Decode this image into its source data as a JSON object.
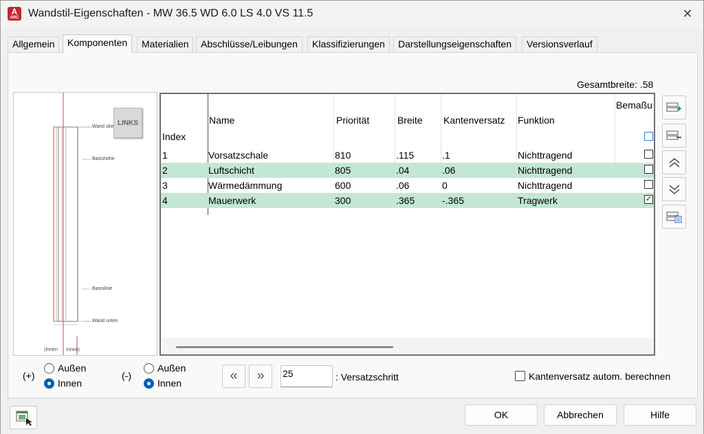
{
  "window": {
    "title": "Wandstil-Eigenschaften - MW 36.5 WD 6.0 LS 4.0 VS 11.5",
    "app_icon_letter": "A",
    "app_icon_sub": "ARC",
    "close_glyph": "✕"
  },
  "tabs": [
    {
      "label": "Allgemein",
      "active": false
    },
    {
      "label": "Komponenten",
      "active": true
    },
    {
      "label": "Materialien",
      "active": false
    },
    {
      "label": "Abschlüsse/Leibungen",
      "active": false
    },
    {
      "label": "Klassifizierungen",
      "active": false
    },
    {
      "label": "Darstellungseigenschaften",
      "active": false
    },
    {
      "label": "Versionsverlauf",
      "active": false
    }
  ],
  "total_width_label": "Gesamtbreite: .58",
  "preview": {
    "badge": "LINKS",
    "labels": {
      "wand_oben": "Wand oben",
      "basishoehe": "Basishöhe",
      "basislinie": "Basislinie",
      "wand_unten": "Wand unten",
      "innen": "(Innen",
      "aussen": "Innen)"
    }
  },
  "grid": {
    "columns": {
      "index": "Index",
      "name": "Name",
      "prioritaet": "Priorität",
      "breite": "Breite",
      "kantenversatz": "Kantenversatz",
      "funktion": "Funktion",
      "bemassung": "Bemaßu"
    },
    "rows": [
      {
        "index": "1",
        "name": "Vorsatzschale",
        "prioritaet": "810",
        "breite": ".115",
        "kantenversatz": ".1",
        "funktion": "Nichttragend",
        "checked": false,
        "selected": false
      },
      {
        "index": "2",
        "name": "Luftschicht",
        "prioritaet": "805",
        "breite": ".04",
        "kantenversatz": ".06",
        "funktion": "Nichttragend",
        "checked": false,
        "selected": true
      },
      {
        "index": "3",
        "name": "Wärmedämmung",
        "prioritaet": "600",
        "breite": ".06",
        "kantenversatz": "0",
        "funktion": "Nichttragend",
        "checked": false,
        "selected": false
      },
      {
        "index": "4",
        "name": "Mauerwerk",
        "prioritaet": "300",
        "breite": ".365",
        "kantenversatz": "-.365",
        "funktion": "Tragwerk",
        "checked": true,
        "selected": true
      }
    ]
  },
  "side_buttons": {
    "add": "add-component-icon",
    "remove": "remove-component-icon",
    "up": "⌃",
    "down": "⌄",
    "details": "details-icon"
  },
  "options": {
    "plus_label": "(+)",
    "minus_label": "(-)",
    "aussen": "Außen",
    "innen": "Innen"
  },
  "offset_step": {
    "prev_glyph": "«",
    "next_glyph": "»",
    "value": "25",
    "label": ": Versatzschritt"
  },
  "auto_edge_offset": {
    "label": "Kantenversatz autom. berechnen",
    "checked": false
  },
  "footer": {
    "ok": "OK",
    "cancel": "Abbrechen",
    "help": "Hilfe"
  },
  "colors": {
    "selected_row": "#c3e6d5",
    "accent_blue": "#005fb8",
    "brand_red": "#c4262e"
  }
}
